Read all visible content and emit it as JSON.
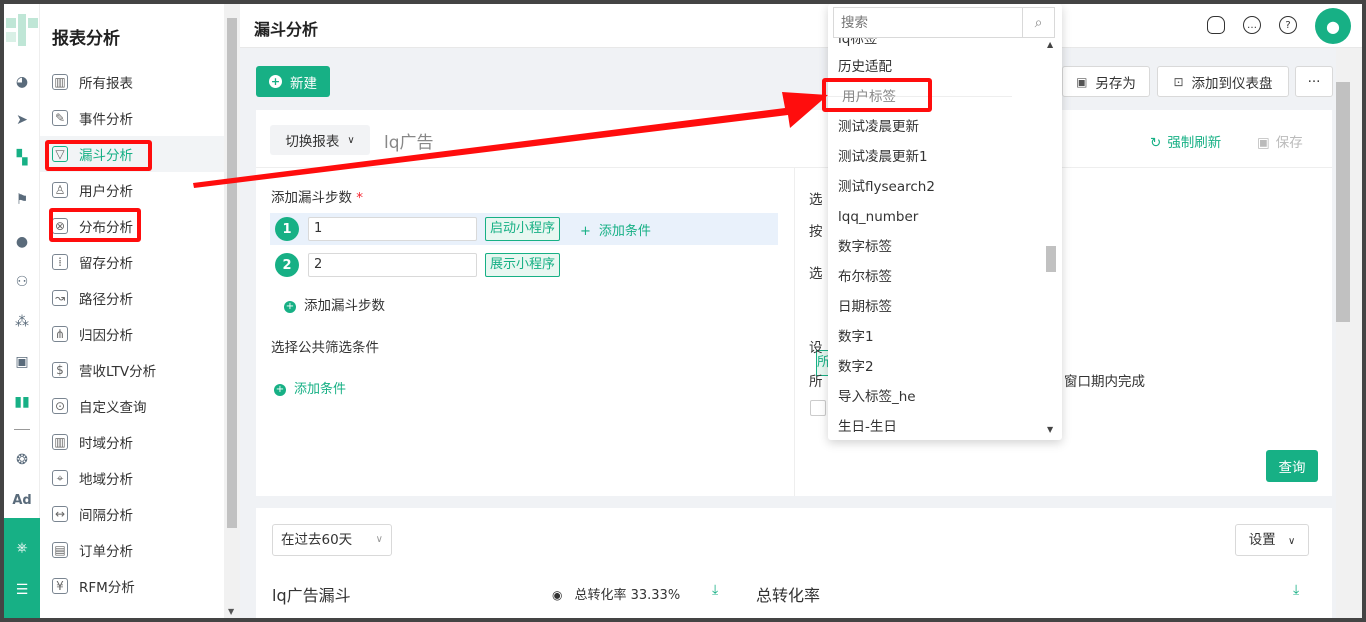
{
  "nav": {
    "title": "报表分析",
    "items": [
      {
        "label": "所有报表",
        "icon": "bar-chart-icon"
      },
      {
        "label": "事件分析",
        "icon": "event-icon"
      },
      {
        "label": "漏斗分析",
        "icon": "funnel-icon"
      },
      {
        "label": "用户分析",
        "icon": "user-icon"
      },
      {
        "label": "分布分析",
        "icon": "distribution-icon"
      },
      {
        "label": "留存分析",
        "icon": "retention-icon"
      },
      {
        "label": "路径分析",
        "icon": "path-icon"
      },
      {
        "label": "归因分析",
        "icon": "attribution-icon"
      },
      {
        "label": "营收LTV分析",
        "icon": "revenue-icon"
      },
      {
        "label": "自定义查询",
        "icon": "custom-query-icon"
      },
      {
        "label": "时域分析",
        "icon": "time-domain-icon"
      },
      {
        "label": "地域分析",
        "icon": "location-icon"
      },
      {
        "label": "间隔分析",
        "icon": "interval-icon"
      },
      {
        "label": "订单分析",
        "icon": "order-icon"
      },
      {
        "label": "RFM分析",
        "icon": "rfm-icon"
      }
    ],
    "active_index": 2
  },
  "rail": {
    "ad_label": "Ad"
  },
  "header": {
    "title": "漏斗分析"
  },
  "toolbar": {
    "new_label": "新建",
    "save_as_label": "另存为",
    "add_dashboard_label": "添加到仪表盘",
    "more_label": "···"
  },
  "report": {
    "switch_label": "切换报表",
    "name": "lq广告",
    "refresh_label": "强制刷新",
    "save_label": "保存"
  },
  "steps": {
    "title": "添加漏斗步数",
    "required_mark": "*",
    "items": [
      {
        "num": "1",
        "value": "1",
        "event": "启动小程序",
        "add_condition": "添加条件"
      },
      {
        "num": "2",
        "value": "2",
        "event": "展示小程序"
      }
    ],
    "add_step_label": "添加漏斗步数"
  },
  "filters": {
    "title": "选择公共筛选条件",
    "add_condition_label": "添加条件"
  },
  "right_panel": {
    "frag_1": "选",
    "frag_2": "按",
    "frag_3": "选",
    "frag_4": "设",
    "frag_5": "所",
    "frag_window": "窗口期内完成",
    "tag_frag": "所",
    "query_label": "查询"
  },
  "result": {
    "range_label": "在过去60天",
    "settings_label": "设置",
    "funnel_name": "lq广告漏斗",
    "conversion_label": "总转化率 33.33%",
    "conversion_title": "总转化率"
  },
  "dropdown": {
    "search_placeholder": "搜索",
    "partial_top": "lq标签",
    "items": [
      "历史适配",
      "用户标签",
      "测试凌晨更新",
      "测试凌晨更新1",
      "测试flysearch2",
      "lqq_number",
      "数字标签",
      "布尔标签",
      "日期标签",
      "数字1",
      "数字2",
      "导入标签_he",
      "生日-生日"
    ],
    "hover_index": 1
  },
  "colors": {
    "accent": "#17b085",
    "annotation": "#ff0d0d",
    "step_highlight": "#e9f1fb"
  }
}
